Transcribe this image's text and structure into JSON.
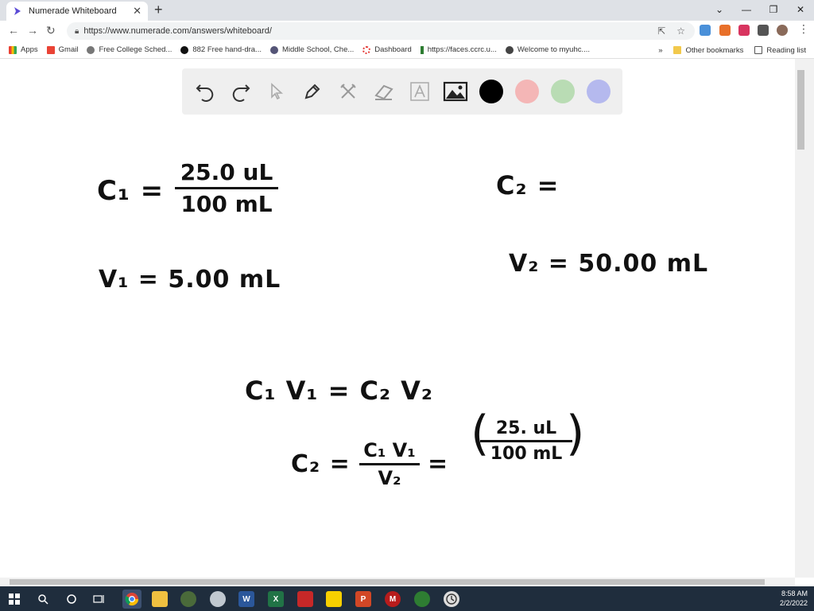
{
  "browser": {
    "tab_title": "Numerade Whiteboard",
    "tab_close": "✕",
    "new_tab": "+",
    "url": "https://www.numerade.com/answers/whiteboard/",
    "window_controls": {
      "minimize": "—",
      "restore": "❐",
      "close": "✕",
      "menu": "⌄"
    }
  },
  "bookmarks": {
    "items": [
      {
        "label": "Apps",
        "color": "#e94235"
      },
      {
        "label": "Gmail",
        "color": "#ea4335"
      },
      {
        "label": "Free College Sched...",
        "color": "#777777"
      },
      {
        "label": "882 Free hand-dra...",
        "color": "#111111"
      },
      {
        "label": "Middle School, Che...",
        "color": "#555577"
      },
      {
        "label": "Dashboard",
        "color": "#e53935"
      },
      {
        "label": "https://faces.ccrc.u...",
        "color": "#2e7d32"
      },
      {
        "label": "Welcome to myuhc....",
        "color": "#444444"
      }
    ],
    "more": "»",
    "other": "Other bookmarks",
    "reading": "Reading list"
  },
  "palette": {
    "swatches": [
      "#000000",
      "#f4b6b6",
      "#b9dcb4",
      "#b5b9ee"
    ]
  },
  "board": {
    "c1_label": "C₁ =",
    "c1_num": "25.0 uL",
    "c1_den": "100 mL",
    "c2_label": "C₂ =",
    "v1": "V₁ =  5.00 mL",
    "v2": "V₂ = 50.00 mL",
    "eq": "C₁ V₁ = C₂ V₂",
    "c2_eq": "C₂ =",
    "c2_num": "C₁ V₁",
    "c2_den": "V₂",
    "equals": "=",
    "paren_num": "25. uL",
    "paren_den": "100 mL"
  },
  "taskbar": {
    "time": "8:58 AM",
    "date": "2/2/2022"
  }
}
